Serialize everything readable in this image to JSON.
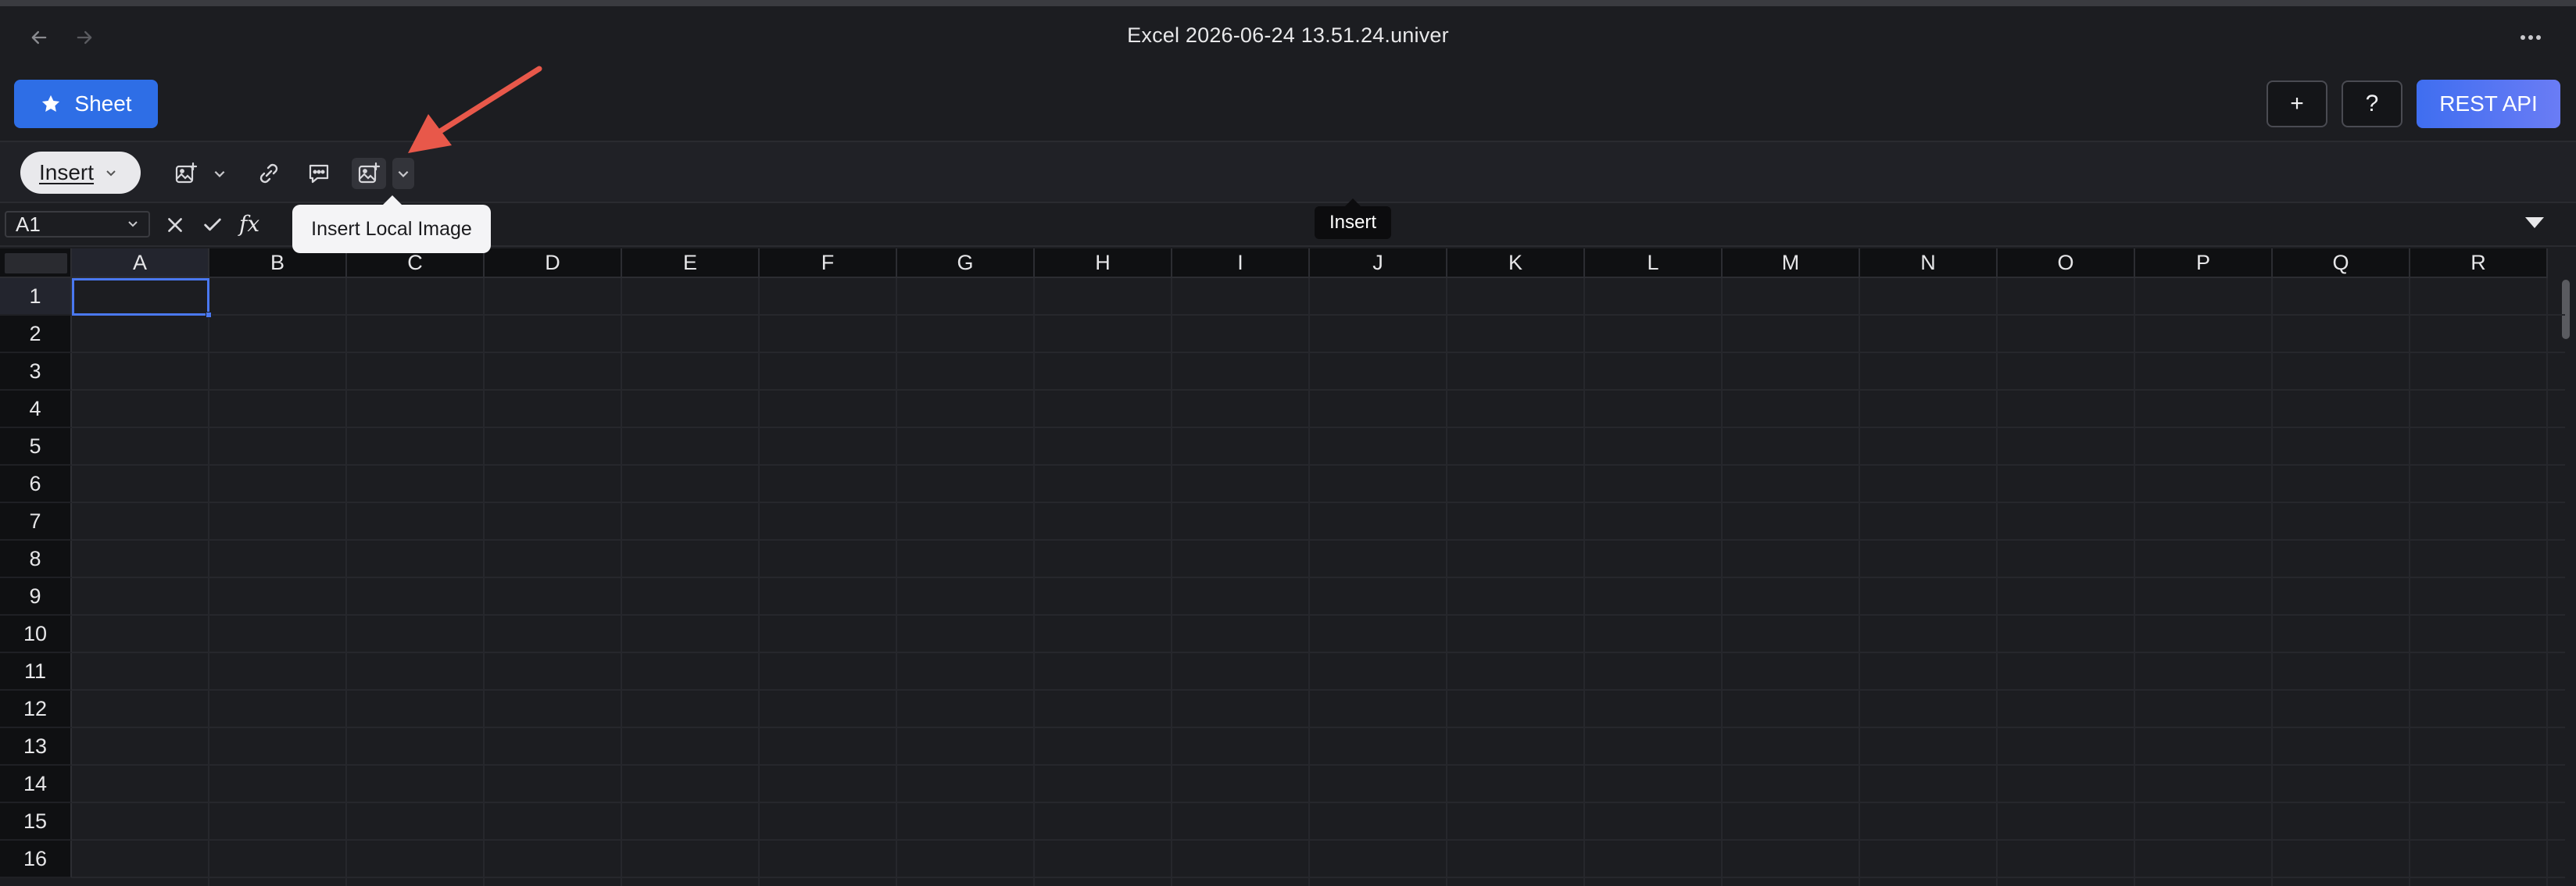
{
  "window": {
    "title": "Excel 2026-06-24 13.51.24.univer",
    "nav_back_icon": "arrow-left-icon",
    "nav_forward_icon": "arrow-right-icon",
    "more_icon": "ellipsis-icon"
  },
  "header": {
    "sheet_button_label": "Sheet",
    "add_button_label": "+",
    "help_button_label": "?",
    "rest_api_button_label": "REST API",
    "colors": {
      "sheet_button": "#2e6ee6",
      "rest_api_gradient_start": "#3f6ef0",
      "rest_api_gradient_end": "#6a7cf5"
    }
  },
  "toolbar": {
    "menu_label": "Insert",
    "tools": [
      {
        "name": "insert-float-image-icon"
      },
      {
        "name": "link-icon"
      },
      {
        "name": "comment-icon"
      },
      {
        "name": "insert-cell-image-icon"
      }
    ]
  },
  "formula_bar": {
    "cell_reference": "A1",
    "fx_label": "fx",
    "formula_value": ""
  },
  "grid": {
    "columns": [
      "A",
      "B",
      "C",
      "D",
      "E",
      "F",
      "G",
      "H",
      "I",
      "J",
      "K",
      "L",
      "M",
      "N",
      "O",
      "P",
      "Q",
      "R"
    ],
    "rows": [
      "1",
      "2",
      "3",
      "4",
      "5",
      "6",
      "7",
      "8",
      "9",
      "10",
      "11",
      "12",
      "13",
      "14",
      "15",
      "16"
    ],
    "active_cell": "A1",
    "accent": "#4a78f0"
  },
  "tooltips": {
    "insert_local_image": "Insert Local Image",
    "insert": "Insert"
  },
  "annotation": {
    "arrow_color": "#e8584a"
  }
}
